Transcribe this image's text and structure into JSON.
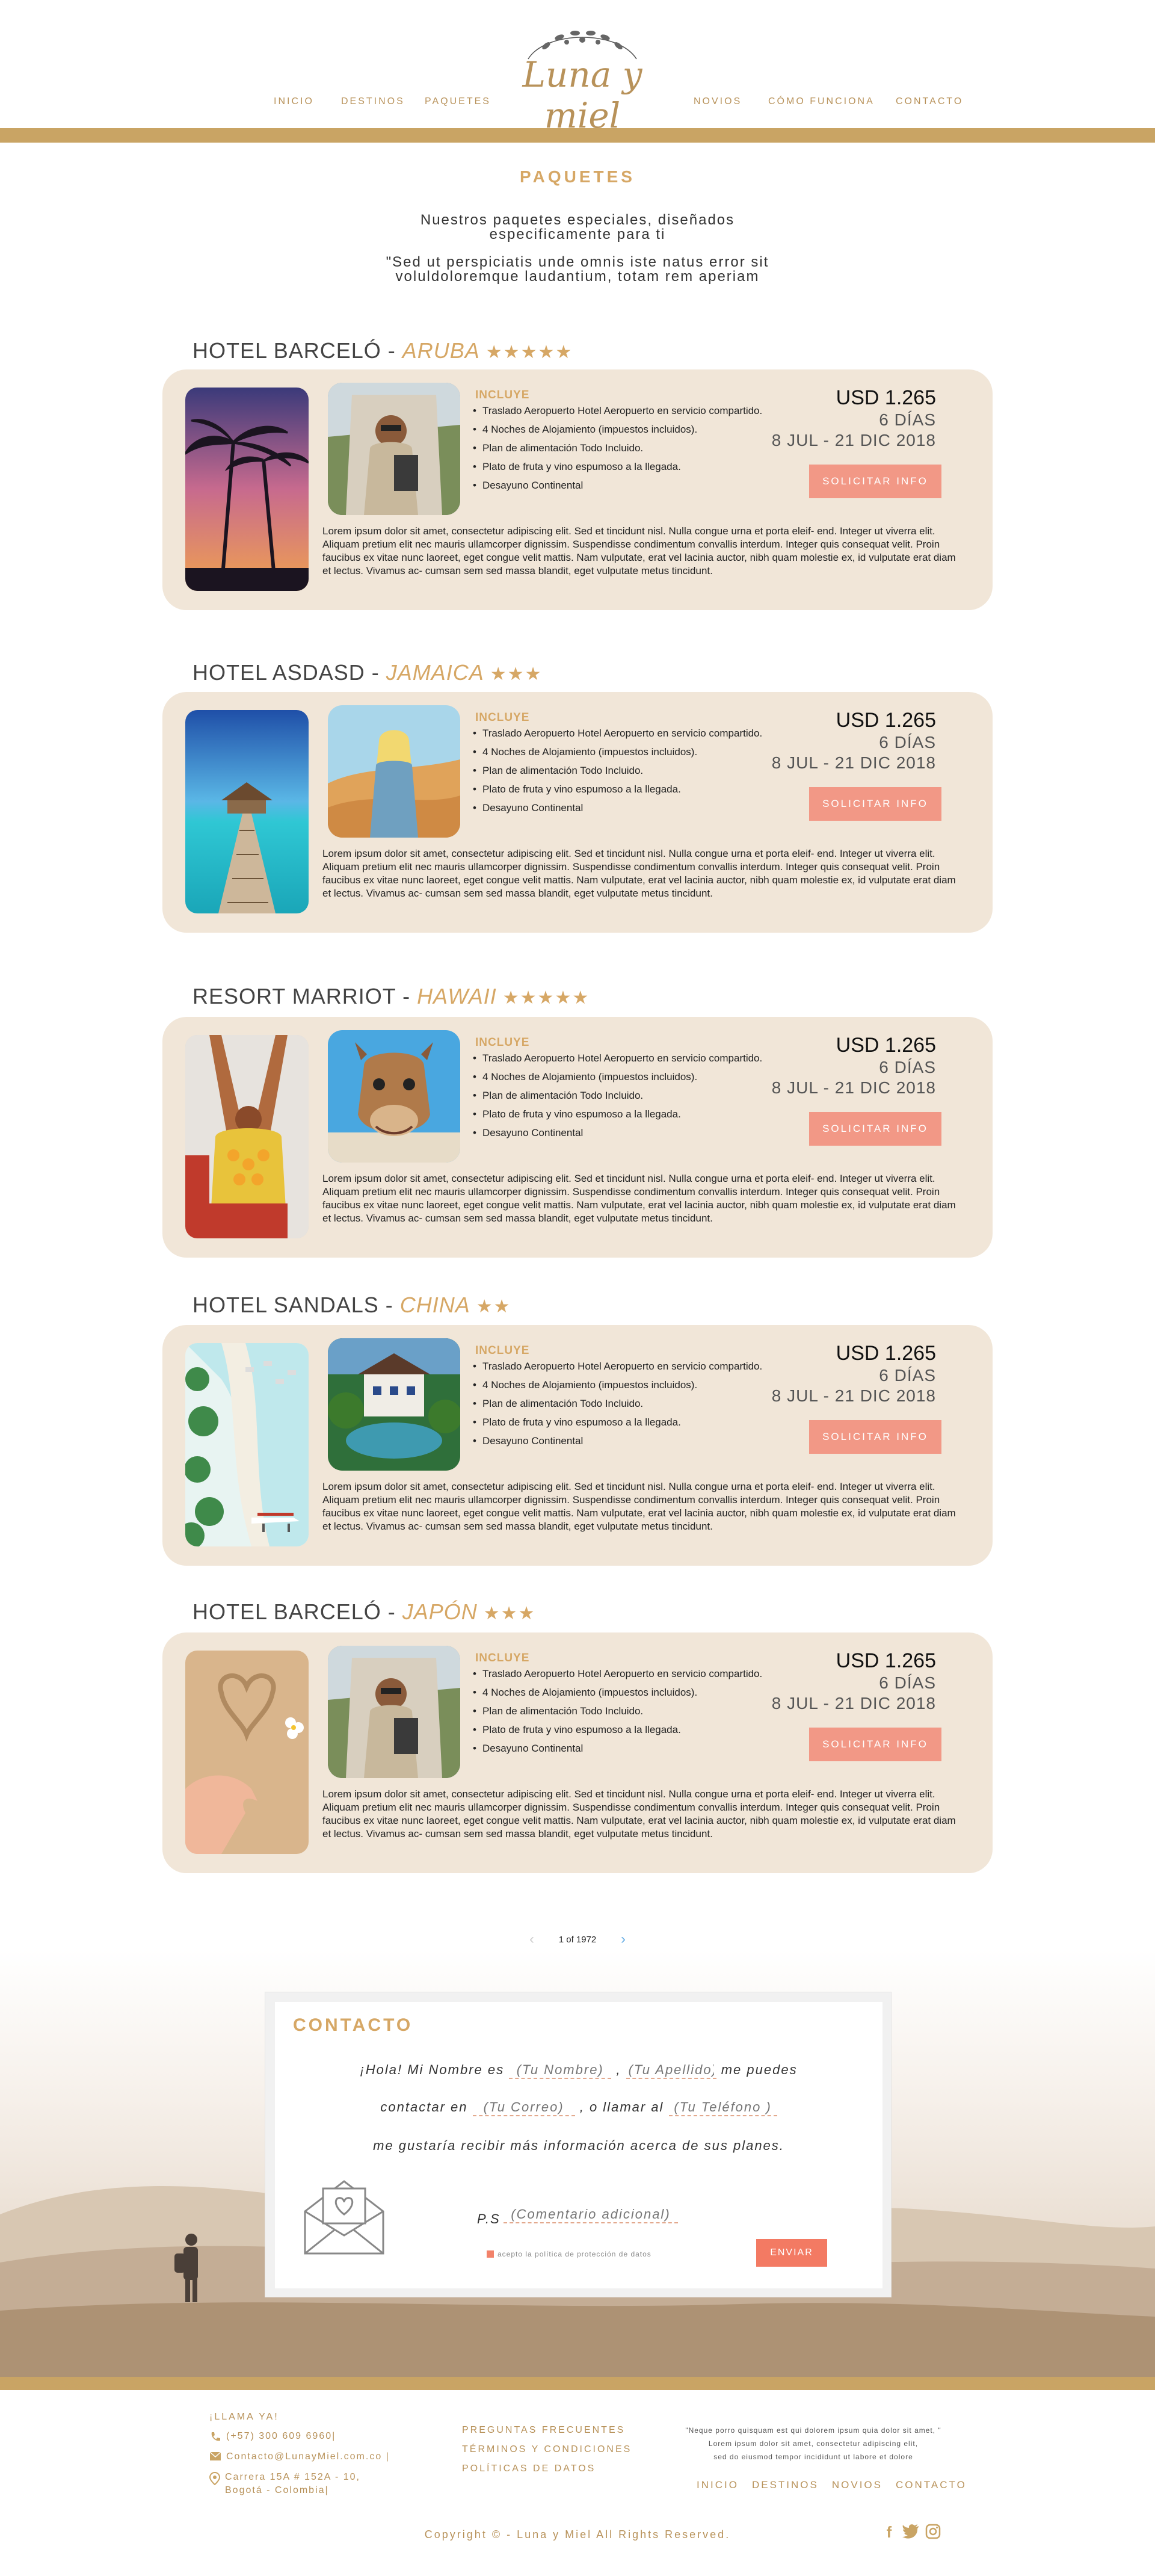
{
  "header": {
    "logo_text": "Luna y miel",
    "nav_left": [
      "INICIO",
      "DESTINOS",
      "PAQUETES"
    ],
    "nav_right": [
      "NOVIOS",
      "CÓMO FUNCIONA",
      "CONTACTO"
    ]
  },
  "intro": {
    "title": "PAQUETES",
    "line1": "Nuestros paquetes especiales, diseñados",
    "line2": "especificamente para ti",
    "line3": "\"Sed ut perspiciatis unde omnis iste natus error sit",
    "line4": "voluldoloremque laudantium, totam rem aperiam"
  },
  "packages": [
    {
      "hotel": "HOTEL BARCELÓ",
      "sep": " - ",
      "destination": "ARUBA",
      "stars": "★★★★★",
      "incluye": "INCLUYE",
      "features": [
        "Traslado Aeropuerto Hotel Aeropuerto en servicio compartido.",
        "4 Noches de Alojamiento (impuestos incluidos).",
        "Plan de alimentación Todo Incluido.",
        "Plato de fruta y vino espumoso a la llegada.",
        "Desayuno Continental"
      ],
      "price": "USD 1.265",
      "days": "6 DÍAS",
      "dates": "8 JUL - 21 DIC 2018",
      "button": "SOLICITAR INFO",
      "description": "Lorem ipsum dolor sit amet, consectetur adipiscing elit. Sed et tincidunt nisl. Nulla congue urna et porta eleif- end. Integer ut viverra elit. Aliquam pretium elit nec mauris ullamcorper dignissim. Suspendisse condimentum convallis interdum. Integer quis consequat velit. Proin faucibus ex vitae nunc laoreet, eget congue velit mattis. Nam vulputate, erat vel lacinia auctor, nibh quam molestie ex, id vulputate erat diam et lectus. Vivamus ac- cumsan sem sed massa blandit, eget vulputate metus tincidunt."
    },
    {
      "hotel": "HOTEL ASDASD",
      "sep": " - ",
      "destination": "JAMAICA",
      "stars": "★★★",
      "incluye": "INCLUYE",
      "features": [
        "Traslado Aeropuerto Hotel Aeropuerto en servicio compartido.",
        "4 Noches de Alojamiento (impuestos incluidos).",
        "Plan de alimentación Todo Incluido.",
        "Plato de fruta y vino espumoso a la llegada.",
        "Desayuno Continental"
      ],
      "price": "USD 1.265",
      "days": "6 DÍAS",
      "dates": "8 JUL - 21 DIC 2018",
      "button": "SOLICITAR INFO",
      "description": "Lorem ipsum dolor sit amet, consectetur adipiscing elit. Sed et tincidunt nisl. Nulla congue urna et porta eleif- end. Integer ut viverra elit. Aliquam pretium elit nec mauris ullamcorper dignissim. Suspendisse condimentum convallis interdum. Integer quis consequat velit. Proin faucibus ex vitae nunc laoreet, eget congue velit mattis. Nam vulputate, erat vel lacinia auctor, nibh quam molestie ex, id vulputate erat diam et lectus. Vivamus ac- cumsan sem sed massa blandit, eget vulputate metus tincidunt."
    },
    {
      "hotel": "RESORT MARRIOT",
      "sep": " - ",
      "destination": "HAWAII",
      "stars": "★★★★★",
      "incluye": "INCLUYE",
      "features": [
        "Traslado Aeropuerto Hotel Aeropuerto en servicio compartido.",
        "4 Noches de Alojamiento (impuestos incluidos).",
        "Plan de alimentación Todo Incluido.",
        "Plato de fruta y vino espumoso a la llegada.",
        "Desayuno Continental"
      ],
      "price": "USD 1.265",
      "days": "6 DÍAS",
      "dates": "8 JUL - 21 DIC 2018",
      "button": "SOLICITAR INFO",
      "description": "Lorem ipsum dolor sit amet, consectetur adipiscing elit. Sed et tincidunt nisl. Nulla congue urna et porta eleif- end. Integer ut viverra elit. Aliquam pretium elit nec mauris ullamcorper dignissim. Suspendisse condimentum convallis interdum. Integer quis consequat velit. Proin faucibus ex vitae nunc laoreet, eget congue velit mattis. Nam vulputate, erat vel lacinia auctor, nibh quam molestie ex, id vulputate erat diam et lectus. Vivamus ac- cumsan sem sed massa blandit, eget vulputate metus tincidunt."
    },
    {
      "hotel": "HOTEL SANDALS",
      "sep": " - ",
      "destination": "CHINA",
      "stars": "★★",
      "incluye": "INCLUYE",
      "features": [
        "Traslado Aeropuerto Hotel Aeropuerto en servicio compartido.",
        "4 Noches de Alojamiento (impuestos incluidos).",
        "Plan de alimentación Todo Incluido.",
        "Plato de fruta y vino espumoso a la llegada.",
        "Desayuno Continental"
      ],
      "price": "USD 1.265",
      "days": "6 DÍAS",
      "dates": "8 JUL - 21 DIC 2018",
      "button": "SOLICITAR INFO",
      "description": "Lorem ipsum dolor sit amet, consectetur adipiscing elit. Sed et tincidunt nisl. Nulla congue urna et porta eleif- end. Integer ut viverra elit. Aliquam pretium elit nec mauris ullamcorper dignissim. Suspendisse condimentum convallis interdum. Integer quis consequat velit. Proin faucibus ex vitae nunc laoreet, eget congue velit mattis. Nam vulputate, erat vel lacinia auctor, nibh quam molestie ex, id vulputate erat diam et lectus. Vivamus ac- cumsan sem sed massa blandit, eget vulputate metus tincidunt."
    },
    {
      "hotel": "HOTEL BARCELÓ",
      "sep": " - ",
      "destination": "JAPÓN",
      "stars": "★★★",
      "incluye": "INCLUYE",
      "features": [
        "Traslado Aeropuerto Hotel Aeropuerto en servicio compartido.",
        "4 Noches de Alojamiento (impuestos incluidos).",
        "Plan de alimentación Todo Incluido.",
        "Plato de fruta y vino espumoso a la llegada.",
        "Desayuno Continental"
      ],
      "price": "USD 1.265",
      "days": "6 DÍAS",
      "dates": "8 JUL - 21 DIC 2018",
      "button": "SOLICITAR INFO",
      "description": "Lorem ipsum dolor sit amet, consectetur adipiscing elit. Sed et tincidunt nisl. Nulla congue urna et porta eleif- end. Integer ut viverra elit. Aliquam pretium elit nec mauris ullamcorper dignissim. Suspendisse condimentum convallis interdum. Integer quis consequat velit. Proin faucibus ex vitae nunc laoreet, eget congue velit mattis. Nam vulputate, erat vel lacinia auctor, nibh quam molestie ex, id vulputate erat diam et lectus. Vivamus ac- cumsan sem sed massa blandit, eget vulputate metus tincidunt."
    }
  ],
  "pagination": {
    "label": "1 of 1972",
    "prev_icon": "chevron-left-icon",
    "next_icon": "chevron-right-icon"
  },
  "contact": {
    "title": "CONTACTO",
    "l1_a": "¡Hola! Mi Nombre es",
    "name_ph": "(Tu Nombre)",
    "l1_b": ",",
    "lastname_ph": "(Tu Apellido)",
    "l1_c": "me puedes",
    "l2_a": "contactar en",
    "email_ph": "(Tu Correo)",
    "l2_b": ", o llamar al",
    "phone_ph": "(Tu Teléfono )",
    "l3": "me gustaría recibir más información acerca de sus planes.",
    "ps_label": "P.S",
    "comment_ph": "(Comentario adicional)",
    "privacy": "acepto la política de protección de datos",
    "send": "ENVIAR"
  },
  "footer": {
    "llama": "¡LLAMA YA!",
    "phone": "(+57) 300 609 6960|",
    "email": "Contacto@LunayMiel.com.co |",
    "address1": "Carrera 15A # 152A - 10,",
    "address2": "Bogotá - Colombia|",
    "links": [
      "PREGUNTAS FRECUENTES",
      "TÉRMINOS Y CONDICIONES",
      "POLÍTICAS DE DATOS"
    ],
    "quote1": "\"Neque porro quisquam est qui dolorem ipsum quia dolor sit amet, \"",
    "quote2": "Lorem ipsum dolor sit amet, consectetur adipiscing elit,",
    "quote3": "sed do eiusmod tempor incididunt ut labore et dolore",
    "nav": [
      "INICIO",
      "DESTINOS",
      "NOVIOS",
      "CONTACTO"
    ],
    "copyright": "Copyright © - Luna y Miel  All Rights Reserved.",
    "social_icons": [
      "facebook-icon",
      "twitter-icon",
      "instagram-icon"
    ]
  },
  "colors": {
    "gold": "#c9a464",
    "accent": "#d6a765",
    "card_bg": "#f1e6d8",
    "button": "#f29886",
    "send": "#f37a63"
  }
}
